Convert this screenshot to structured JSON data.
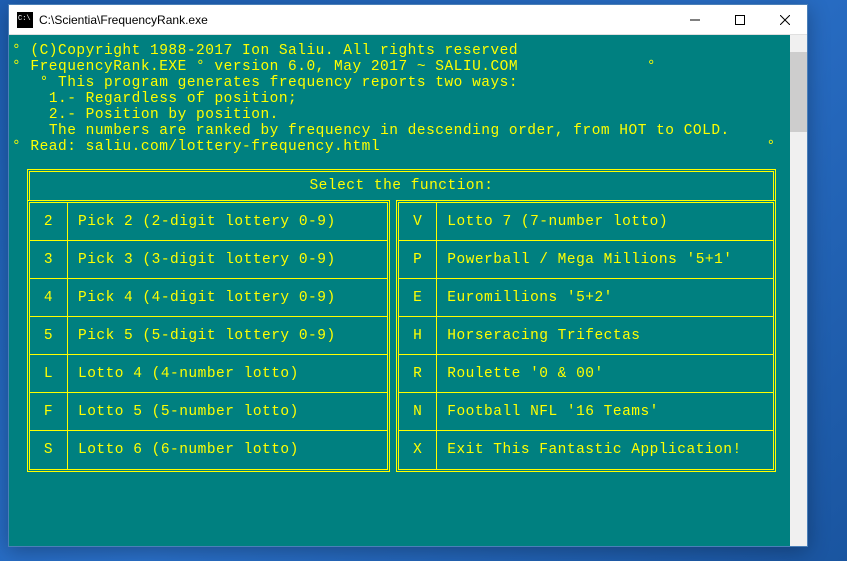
{
  "window": {
    "title": "C:\\Scientia\\FrequencyRank.exe"
  },
  "header": {
    "line1_pre": "° ",
    "copyright": "(C)Copyright 1988-2017 Ion Saliu. All rights reserved",
    "line2_pre": "° ",
    "product": "FrequencyRank.EXE ° version 6.0, May 2017 ~ SALIU.COM",
    "line2_suf": "              °",
    "line3_pre": "   ° ",
    "desc": "This program generates frequency reports two ways:",
    "opt1_pre": "    ",
    "opt1": "1.- Regardless of position;",
    "opt2_pre": "    ",
    "opt2": "2.- Position by position.",
    "note_pre": "    ",
    "note": "The numbers are ranked by frequency in descending order, from HOT to COLD.",
    "read_pre": "° ",
    "read": "Read: saliu.com/lottery-frequency.html",
    "read_suf": "                                          °"
  },
  "menu": {
    "title": "Select the function:",
    "left": [
      {
        "key": "2",
        "label": "Pick 2 (2-digit lottery 0-9)"
      },
      {
        "key": "3",
        "label": "Pick 3 (3-digit lottery 0-9)"
      },
      {
        "key": "4",
        "label": "Pick 4 (4-digit lottery 0-9)"
      },
      {
        "key": "5",
        "label": "Pick 5 (5-digit lottery 0-9)"
      },
      {
        "key": "L",
        "label": "Lotto 4 (4-number lotto)"
      },
      {
        "key": "F",
        "label": "Lotto 5 (5-number lotto)"
      },
      {
        "key": "S",
        "label": "Lotto 6 (6-number lotto)"
      }
    ],
    "right": [
      {
        "key": "V",
        "label": "Lotto 7 (7-number lotto)"
      },
      {
        "key": "P",
        "label": "Powerball / Mega Millions '5+1'"
      },
      {
        "key": "E",
        "label": "Euromillions '5+2'"
      },
      {
        "key": "H",
        "label": "Horseracing Trifectas"
      },
      {
        "key": "R",
        "label": "Roulette '0 & 00'"
      },
      {
        "key": "N",
        "label": "Football NFL '16 Teams'"
      },
      {
        "key": "X",
        "label": "Exit This Fantastic Application!"
      }
    ]
  }
}
